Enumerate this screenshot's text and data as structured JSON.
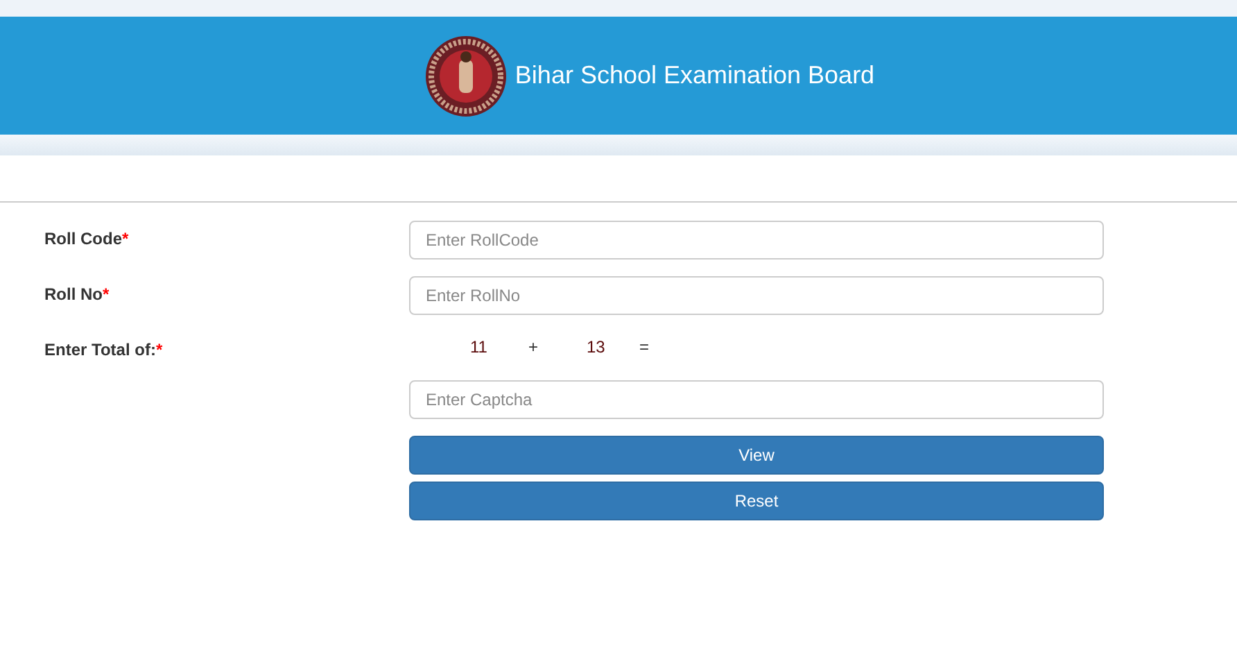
{
  "header": {
    "title": "Bihar School Examination Board"
  },
  "fields": [
    {
      "label": "Roll Code",
      "required_mark": "*",
      "placeholder": "Enter RollCode"
    },
    {
      "label": "Roll No",
      "required_mark": "*",
      "placeholder": "Enter RollNo"
    }
  ],
  "captcha": {
    "label": "Enter Total of:",
    "required_mark": "*",
    "first": "11",
    "operator": "+",
    "second": "13",
    "equals": "=",
    "placeholder": "Enter Captcha"
  },
  "buttons": [
    "View",
    "Reset"
  ]
}
